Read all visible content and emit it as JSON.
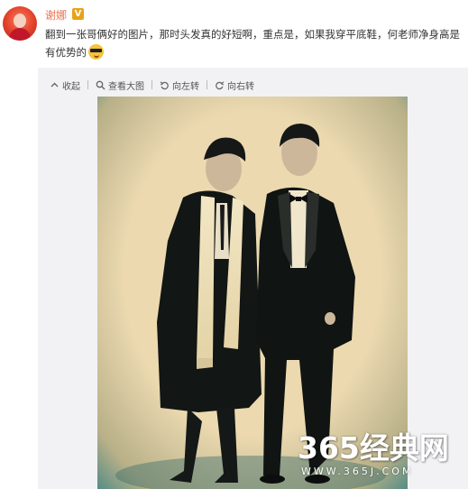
{
  "post": {
    "username": "谢娜",
    "badge": "V",
    "text": "翻到一张哥俩好的图片，那时头发真的好短啊，重点是，如果我穿平底鞋，何老师净身高是有优势的",
    "emoji_icon": "cool-sunglasses-emoji"
  },
  "toolbar": {
    "collapse_label": "收起",
    "view_large_label": "查看大图",
    "rotate_left_label": "向左转",
    "rotate_right_label": "向右转"
  },
  "photo": {
    "description_icon": "photo-image"
  },
  "watermark": {
    "title": "365经典网",
    "url": "WWW.365J.COM"
  },
  "colors": {
    "username": "#eb7350",
    "badge": "#e8a317",
    "photo_background": "#e8d4a9"
  }
}
